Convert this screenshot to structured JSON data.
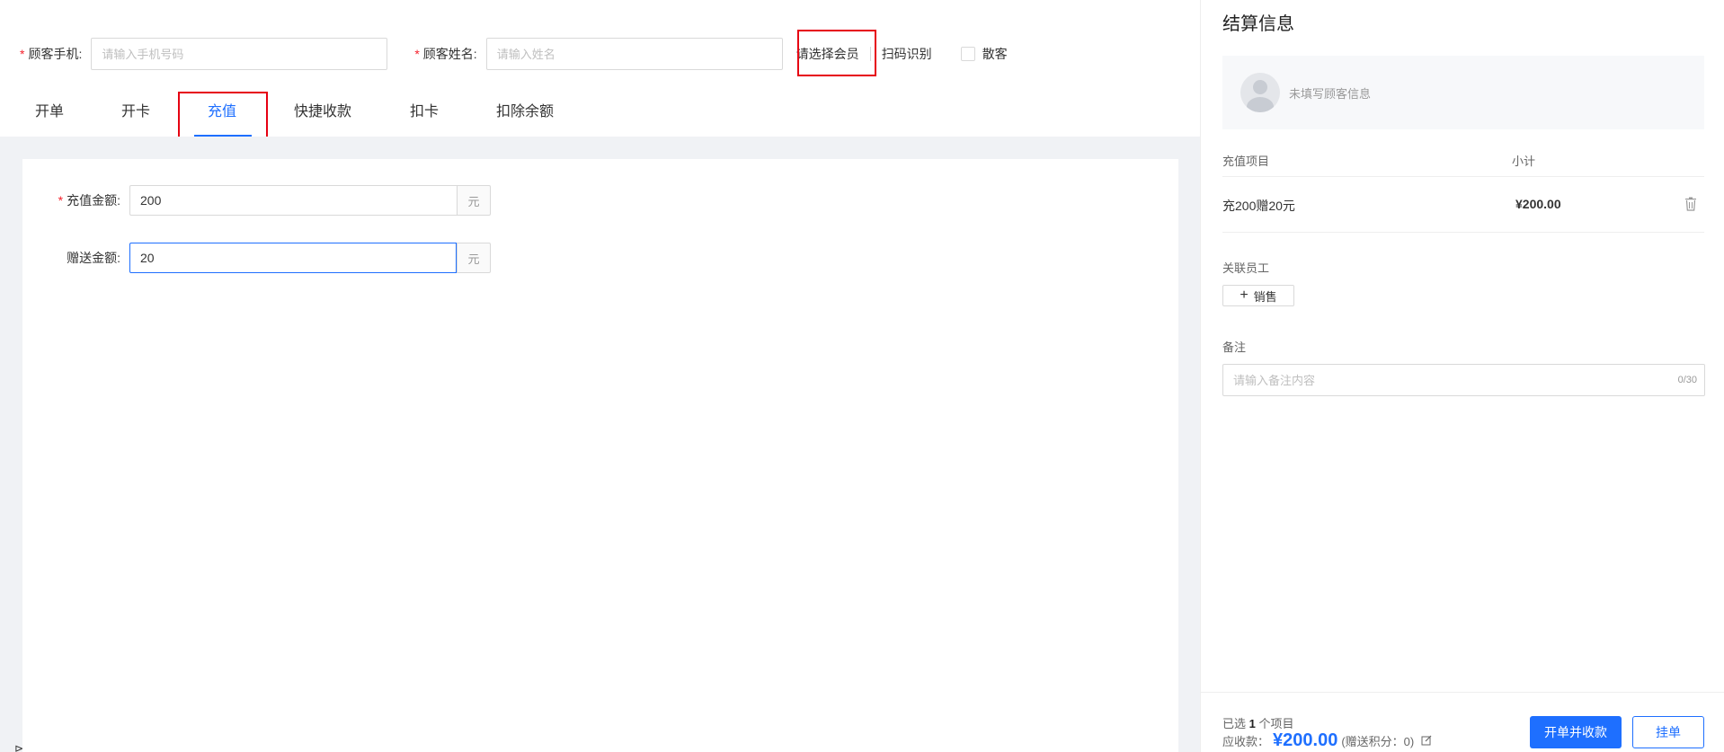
{
  "customer": {
    "phone_label": "顾客手机:",
    "phone_placeholder": "请输入手机号码",
    "name_label": "顾客姓名:",
    "name_placeholder": "请输入姓名",
    "select_member": "请选择会员",
    "scan": "扫码识别",
    "walk_in": "散客",
    "required_mark": "*"
  },
  "tabs": [
    {
      "label": "开单"
    },
    {
      "label": "开卡"
    },
    {
      "label": "充值",
      "active": true
    },
    {
      "label": "快捷收款"
    },
    {
      "label": "扣卡"
    },
    {
      "label": "扣除余额"
    }
  ],
  "form": {
    "recharge_label": "充值金额:",
    "recharge_value": "200",
    "gift_label": "赠送金额:",
    "gift_value": "20",
    "unit": "元"
  },
  "settlement": {
    "title": "结算信息",
    "customer_hint": "未填写顾客信息",
    "col_item": "充值项目",
    "col_subtotal": "小计",
    "row_item": "充200赠20元",
    "row_subtotal": "¥200.00",
    "staff_label": "关联员工",
    "sales_button": "销售",
    "remark_label": "备注",
    "remark_placeholder": "请输入备注内容",
    "remark_count": "0/30",
    "selected_prefix": "已选",
    "selected_count": "1",
    "selected_suffix": "个项目",
    "due_label": "应收款：",
    "due_amount": "¥200.00",
    "points_text": "(赠送积分：0)",
    "checkout_button": "开单并收款",
    "hold_button": "挂单"
  },
  "colors": {
    "accent": "#1e6fff",
    "highlight_box": "#e60012"
  }
}
